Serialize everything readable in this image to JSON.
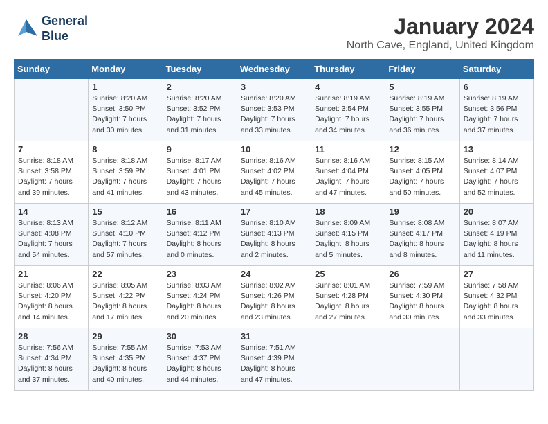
{
  "header": {
    "logo_line1": "General",
    "logo_line2": "Blue",
    "month": "January 2024",
    "location": "North Cave, England, United Kingdom"
  },
  "days_of_week": [
    "Sunday",
    "Monday",
    "Tuesday",
    "Wednesday",
    "Thursday",
    "Friday",
    "Saturday"
  ],
  "weeks": [
    [
      {
        "day": "",
        "info": ""
      },
      {
        "day": "1",
        "info": "Sunrise: 8:20 AM\nSunset: 3:50 PM\nDaylight: 7 hours\nand 30 minutes."
      },
      {
        "day": "2",
        "info": "Sunrise: 8:20 AM\nSunset: 3:52 PM\nDaylight: 7 hours\nand 31 minutes."
      },
      {
        "day": "3",
        "info": "Sunrise: 8:20 AM\nSunset: 3:53 PM\nDaylight: 7 hours\nand 33 minutes."
      },
      {
        "day": "4",
        "info": "Sunrise: 8:19 AM\nSunset: 3:54 PM\nDaylight: 7 hours\nand 34 minutes."
      },
      {
        "day": "5",
        "info": "Sunrise: 8:19 AM\nSunset: 3:55 PM\nDaylight: 7 hours\nand 36 minutes."
      },
      {
        "day": "6",
        "info": "Sunrise: 8:19 AM\nSunset: 3:56 PM\nDaylight: 7 hours\nand 37 minutes."
      }
    ],
    [
      {
        "day": "7",
        "info": "Sunrise: 8:18 AM\nSunset: 3:58 PM\nDaylight: 7 hours\nand 39 minutes."
      },
      {
        "day": "8",
        "info": "Sunrise: 8:18 AM\nSunset: 3:59 PM\nDaylight: 7 hours\nand 41 minutes."
      },
      {
        "day": "9",
        "info": "Sunrise: 8:17 AM\nSunset: 4:01 PM\nDaylight: 7 hours\nand 43 minutes."
      },
      {
        "day": "10",
        "info": "Sunrise: 8:16 AM\nSunset: 4:02 PM\nDaylight: 7 hours\nand 45 minutes."
      },
      {
        "day": "11",
        "info": "Sunrise: 8:16 AM\nSunset: 4:04 PM\nDaylight: 7 hours\nand 47 minutes."
      },
      {
        "day": "12",
        "info": "Sunrise: 8:15 AM\nSunset: 4:05 PM\nDaylight: 7 hours\nand 50 minutes."
      },
      {
        "day": "13",
        "info": "Sunrise: 8:14 AM\nSunset: 4:07 PM\nDaylight: 7 hours\nand 52 minutes."
      }
    ],
    [
      {
        "day": "14",
        "info": "Sunrise: 8:13 AM\nSunset: 4:08 PM\nDaylight: 7 hours\nand 54 minutes."
      },
      {
        "day": "15",
        "info": "Sunrise: 8:12 AM\nSunset: 4:10 PM\nDaylight: 7 hours\nand 57 minutes."
      },
      {
        "day": "16",
        "info": "Sunrise: 8:11 AM\nSunset: 4:12 PM\nDaylight: 8 hours\nand 0 minutes."
      },
      {
        "day": "17",
        "info": "Sunrise: 8:10 AM\nSunset: 4:13 PM\nDaylight: 8 hours\nand 2 minutes."
      },
      {
        "day": "18",
        "info": "Sunrise: 8:09 AM\nSunset: 4:15 PM\nDaylight: 8 hours\nand 5 minutes."
      },
      {
        "day": "19",
        "info": "Sunrise: 8:08 AM\nSunset: 4:17 PM\nDaylight: 8 hours\nand 8 minutes."
      },
      {
        "day": "20",
        "info": "Sunrise: 8:07 AM\nSunset: 4:19 PM\nDaylight: 8 hours\nand 11 minutes."
      }
    ],
    [
      {
        "day": "21",
        "info": "Sunrise: 8:06 AM\nSunset: 4:20 PM\nDaylight: 8 hours\nand 14 minutes."
      },
      {
        "day": "22",
        "info": "Sunrise: 8:05 AM\nSunset: 4:22 PM\nDaylight: 8 hours\nand 17 minutes."
      },
      {
        "day": "23",
        "info": "Sunrise: 8:03 AM\nSunset: 4:24 PM\nDaylight: 8 hours\nand 20 minutes."
      },
      {
        "day": "24",
        "info": "Sunrise: 8:02 AM\nSunset: 4:26 PM\nDaylight: 8 hours\nand 23 minutes."
      },
      {
        "day": "25",
        "info": "Sunrise: 8:01 AM\nSunset: 4:28 PM\nDaylight: 8 hours\nand 27 minutes."
      },
      {
        "day": "26",
        "info": "Sunrise: 7:59 AM\nSunset: 4:30 PM\nDaylight: 8 hours\nand 30 minutes."
      },
      {
        "day": "27",
        "info": "Sunrise: 7:58 AM\nSunset: 4:32 PM\nDaylight: 8 hours\nand 33 minutes."
      }
    ],
    [
      {
        "day": "28",
        "info": "Sunrise: 7:56 AM\nSunset: 4:34 PM\nDaylight: 8 hours\nand 37 minutes."
      },
      {
        "day": "29",
        "info": "Sunrise: 7:55 AM\nSunset: 4:35 PM\nDaylight: 8 hours\nand 40 minutes."
      },
      {
        "day": "30",
        "info": "Sunrise: 7:53 AM\nSunset: 4:37 PM\nDaylight: 8 hours\nand 44 minutes."
      },
      {
        "day": "31",
        "info": "Sunrise: 7:51 AM\nSunset: 4:39 PM\nDaylight: 8 hours\nand 47 minutes."
      },
      {
        "day": "",
        "info": ""
      },
      {
        "day": "",
        "info": ""
      },
      {
        "day": "",
        "info": ""
      }
    ]
  ]
}
